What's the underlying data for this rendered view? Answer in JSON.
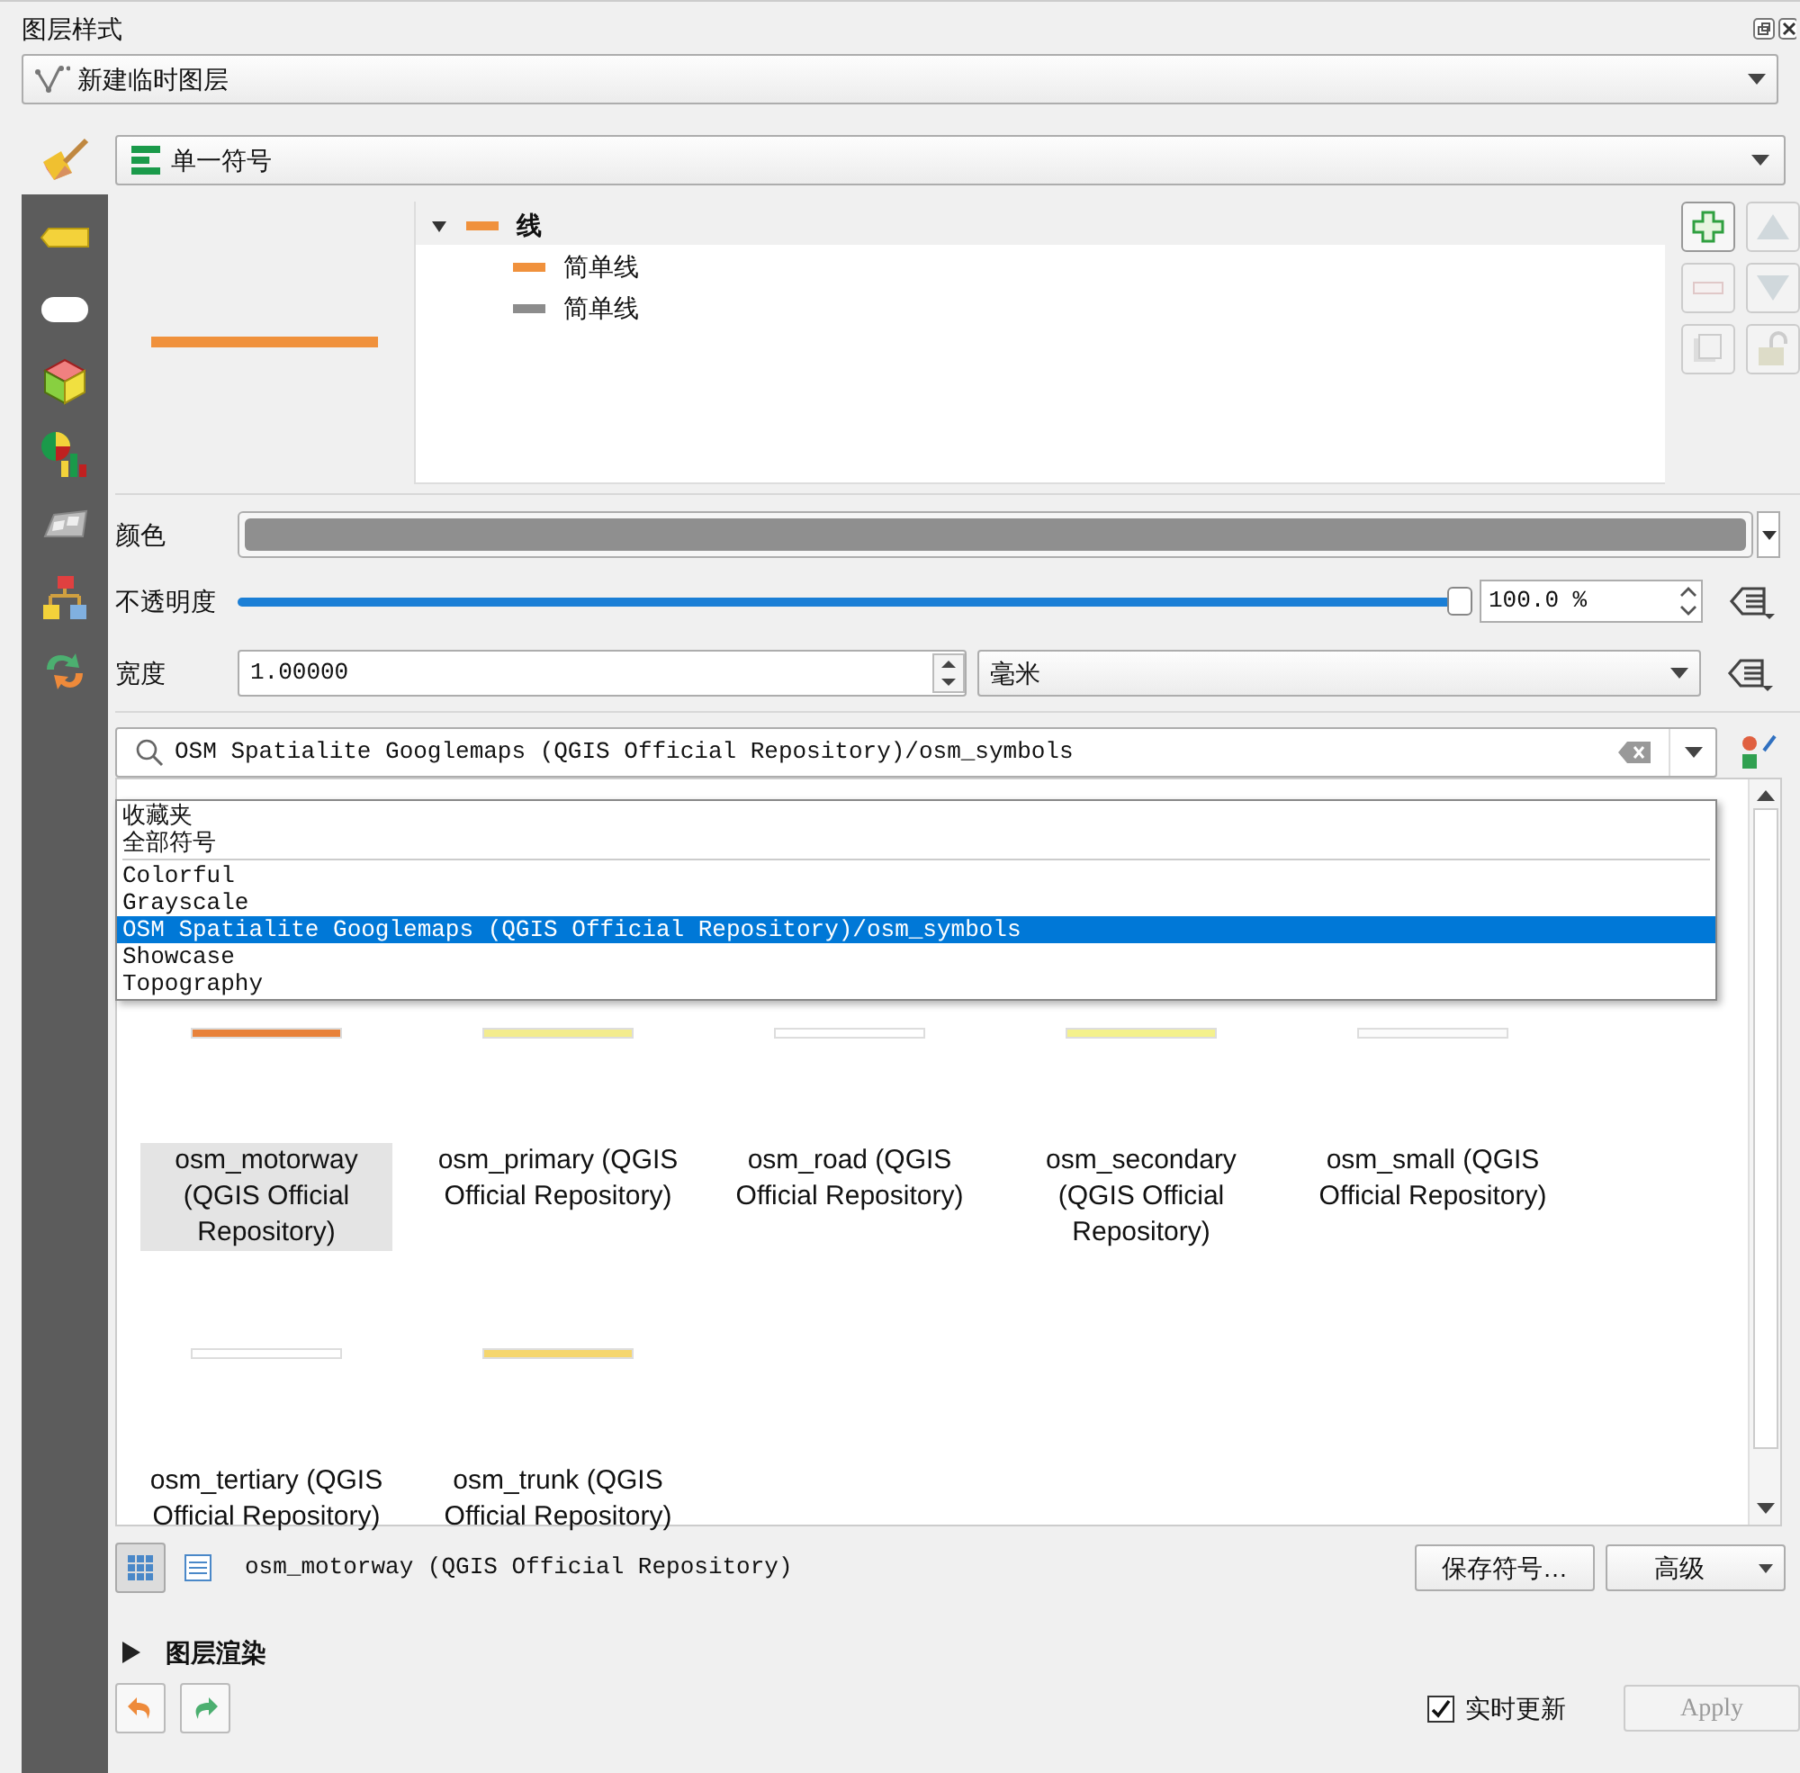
{
  "panel": {
    "title": "图层样式"
  },
  "layer_combo": {
    "value": "新建临时图层"
  },
  "renderer_combo": {
    "value": "单一符号"
  },
  "symbol_tree": [
    {
      "label": "线",
      "color": "#f0913c",
      "expanded": true,
      "children": [
        {
          "label": "简单线",
          "color": "#f0913c"
        },
        {
          "label": "简单线",
          "color": "#8c8c8c"
        }
      ]
    }
  ],
  "color_row": {
    "label": "颜色"
  },
  "opacity_row": {
    "label": "不透明度",
    "level": 1,
    "value": "100.0 %"
  },
  "width_row": {
    "label": "宽度",
    "value": "1.00000",
    "unit": "毫米"
  },
  "library_search": {
    "value": "OSM Spatialite Googlemaps (QGIS Official Repository)/osm_symbols"
  },
  "library_dropdown": [
    {
      "label": "收藏夹",
      "selected": false,
      "divider_after": false
    },
    {
      "label": "全部符号",
      "selected": false,
      "divider_after": true
    },
    {
      "label": "Colorful",
      "selected": false,
      "divider_after": false
    },
    {
      "label": "Grayscale",
      "selected": false,
      "divider_after": false
    },
    {
      "label": "OSM Spatialite Googlemaps (QGIS Official Repository)/osm_symbols",
      "selected": true,
      "divider_after": false
    },
    {
      "label": "Showcase",
      "selected": false,
      "divider_after": false
    },
    {
      "label": "Topography",
      "selected": false,
      "divider_after": false
    }
  ],
  "symbols": [
    {
      "label": "osm_motorway (QGIS Official Repository)",
      "color": "#e8823a",
      "selected": true
    },
    {
      "label": "osm_primary (QGIS Official Repository)",
      "color": "#f3ec8e",
      "selected": false
    },
    {
      "label": "osm_road (QGIS Official Repository)",
      "color": "#ffffff",
      "selected": false
    },
    {
      "label": "osm_secondary (QGIS Official Repository)",
      "color": "#f4f18c",
      "selected": false
    },
    {
      "label": "osm_small (QGIS Official Repository)",
      "color": "#fbfbfb",
      "selected": false
    },
    {
      "label": "osm_tertiary (QGIS Official Repository)",
      "color": "#ffffff",
      "selected": false
    },
    {
      "label": "osm_trunk (QGIS Official Repository)",
      "color": "#f5d66e",
      "selected": false
    }
  ],
  "view_buttons": [
    {
      "kind": "grid",
      "selected": true
    },
    {
      "kind": "list",
      "selected": false
    }
  ],
  "selected_symbol": "osm_motorway (QGIS Official Repository)",
  "save_button": "保存符号…",
  "advanced_button": "高级",
  "layer_rendering": {
    "label": "图层渲染",
    "expanded": false
  },
  "live_update": {
    "label": "实时更新",
    "checked": true
  },
  "apply_button": {
    "label": "Apply",
    "disabled": true
  }
}
